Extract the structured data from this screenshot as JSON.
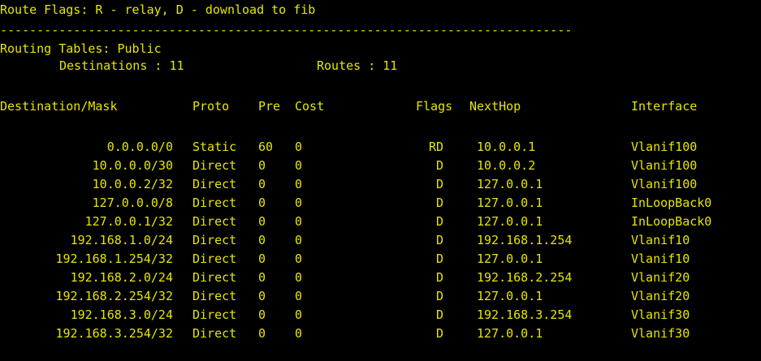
{
  "terminal": {
    "text_color": "#e6e600",
    "background": "#000000"
  },
  "header": {
    "flags_line": "Route Flags: R - relay, D - download to fib",
    "separator": "------------------------------------------------------------------------------",
    "routing_tables": "Routing Tables: Public",
    "destinations_label": "Destinations : 11",
    "routes_label": "Routes : 11"
  },
  "columns": {
    "destination": "Destination/Mask",
    "proto": "Proto",
    "pre": "Pre",
    "cost": "Cost",
    "flags": "Flags",
    "nexthop": "NextHop",
    "interface": "Interface"
  },
  "routes": [
    {
      "dest": "0.0.0.0/0",
      "proto": "Static",
      "pre": "60",
      "cost": "0",
      "flags": "RD",
      "nexthop": "10.0.0.1",
      "iface": "Vlanif100"
    },
    {
      "dest": "10.0.0.0/30",
      "proto": "Direct",
      "pre": "0",
      "cost": "0",
      "flags": "D",
      "nexthop": "10.0.0.2",
      "iface": "Vlanif100"
    },
    {
      "dest": "10.0.0.2/32",
      "proto": "Direct",
      "pre": "0",
      "cost": "0",
      "flags": "D",
      "nexthop": "127.0.0.1",
      "iface": "Vlanif100"
    },
    {
      "dest": "127.0.0.0/8",
      "proto": "Direct",
      "pre": "0",
      "cost": "0",
      "flags": "D",
      "nexthop": "127.0.0.1",
      "iface": "InLoopBack0"
    },
    {
      "dest": "127.0.0.1/32",
      "proto": "Direct",
      "pre": "0",
      "cost": "0",
      "flags": "D",
      "nexthop": "127.0.0.1",
      "iface": "InLoopBack0"
    },
    {
      "dest": "192.168.1.0/24",
      "proto": "Direct",
      "pre": "0",
      "cost": "0",
      "flags": "D",
      "nexthop": "192.168.1.254",
      "iface": "Vlanif10"
    },
    {
      "dest": "192.168.1.254/32",
      "proto": "Direct",
      "pre": "0",
      "cost": "0",
      "flags": "D",
      "nexthop": "127.0.0.1",
      "iface": "Vlanif10"
    },
    {
      "dest": "192.168.2.0/24",
      "proto": "Direct",
      "pre": "0",
      "cost": "0",
      "flags": "D",
      "nexthop": "192.168.2.254",
      "iface": "Vlanif20"
    },
    {
      "dest": "192.168.2.254/32",
      "proto": "Direct",
      "pre": "0",
      "cost": "0",
      "flags": "D",
      "nexthop": "127.0.0.1",
      "iface": "Vlanif20"
    },
    {
      "dest": "192.168.3.0/24",
      "proto": "Direct",
      "pre": "0",
      "cost": "0",
      "flags": "D",
      "nexthop": "192.168.3.254",
      "iface": "Vlanif30"
    },
    {
      "dest": "192.168.3.254/32",
      "proto": "Direct",
      "pre": "0",
      "cost": "0",
      "flags": "D",
      "nexthop": "127.0.0.1",
      "iface": "Vlanif30"
    }
  ]
}
